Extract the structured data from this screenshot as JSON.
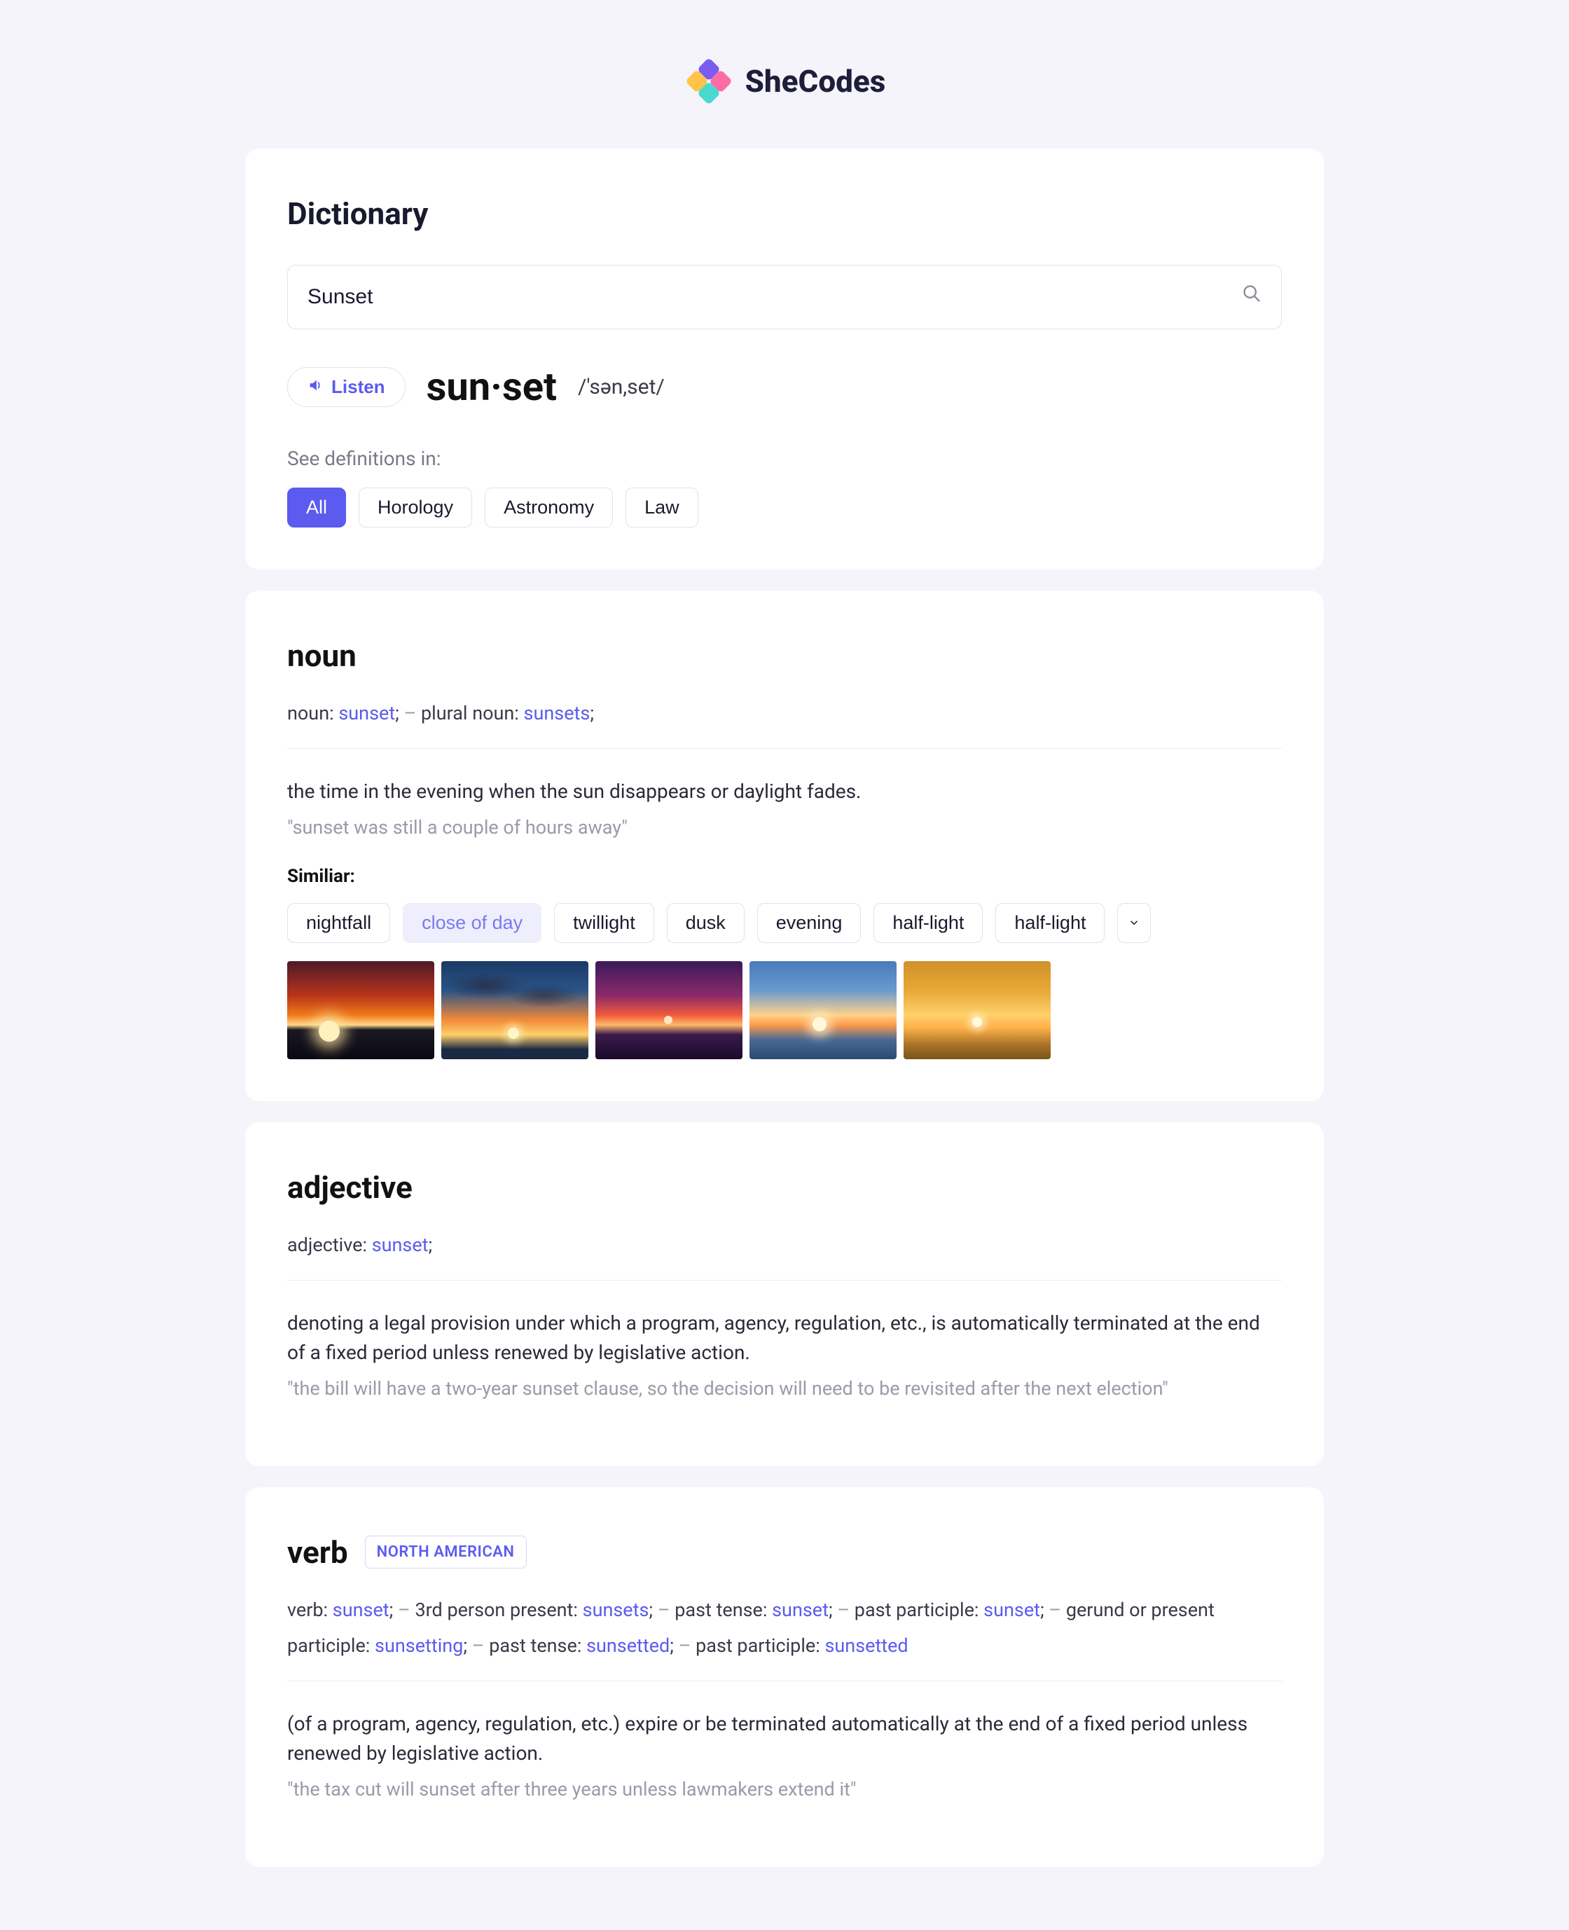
{
  "brand": {
    "name": "SheCodes"
  },
  "header": {
    "title": "Dictionary",
    "search_value": "Sunset",
    "search_placeholder": ""
  },
  "listen_label": "Listen",
  "word_display": "sun·set",
  "phonetic": "/'sən,set/",
  "see_definitions_label": "See definitions in:",
  "category_chips": [
    "All",
    "Horology",
    "Astronomy",
    "Law"
  ],
  "active_category": "All",
  "entries": [
    {
      "pos": "noun",
      "forms_parts": [
        {
          "t": "plain",
          "v": "noun: "
        },
        {
          "t": "hl",
          "v": "sunset"
        },
        {
          "t": "plain",
          "v": ";"
        },
        {
          "t": "sep",
          "v": "   –   "
        },
        {
          "t": "plain",
          "v": "plural noun: "
        },
        {
          "t": "hl",
          "v": "sunsets"
        },
        {
          "t": "plain",
          "v": ";"
        }
      ],
      "definition": "the time in the evening when the sun disappears or daylight fades.",
      "example": "\"sunset was still a couple of hours away\"",
      "similar_label": "Similiar:",
      "similar": [
        "nightfall",
        "close of day",
        "twillight",
        "dusk",
        "evening",
        "half-light",
        "half-light"
      ],
      "soft_similar_index": 1,
      "show_expand": true,
      "thumbs": 5
    },
    {
      "pos": "adjective",
      "forms_parts": [
        {
          "t": "plain",
          "v": "adjective: "
        },
        {
          "t": "hl",
          "v": "sunset"
        },
        {
          "t": "plain",
          "v": ";"
        }
      ],
      "definition": "denoting a legal provision under which a program, agency, regulation, etc., is automatically terminated at the end of a fixed period unless renewed by legislative action.",
      "example": "\"the bill will have a two-year sunset clause, so the decision will need to be revisited after the next election\""
    },
    {
      "pos": "verb",
      "badge": "NORTH AMERICAN",
      "forms_parts": [
        {
          "t": "plain",
          "v": "verb: "
        },
        {
          "t": "hl",
          "v": "sunset"
        },
        {
          "t": "plain",
          "v": ";"
        },
        {
          "t": "sep",
          "v": "   –   "
        },
        {
          "t": "plain",
          "v": "3rd person present: "
        },
        {
          "t": "hl",
          "v": "sunsets"
        },
        {
          "t": "plain",
          "v": ";"
        },
        {
          "t": "sep",
          "v": "   –   "
        },
        {
          "t": "plain",
          "v": "past tense: "
        },
        {
          "t": "hl",
          "v": "sunset"
        },
        {
          "t": "plain",
          "v": ";"
        },
        {
          "t": "sep",
          "v": "   –   "
        },
        {
          "t": "plain",
          "v": "past participle: "
        },
        {
          "t": "hl",
          "v": "sunset"
        },
        {
          "t": "plain",
          "v": ";"
        },
        {
          "t": "sep",
          "v": "   –   "
        },
        {
          "t": "plain",
          "v": "gerund or present participle: "
        },
        {
          "t": "hl",
          "v": "sunsetting"
        },
        {
          "t": "plain",
          "v": ";"
        },
        {
          "t": "sep",
          "v": "   –   "
        },
        {
          "t": "plain",
          "v": "past tense: "
        },
        {
          "t": "hl",
          "v": "sunsetted"
        },
        {
          "t": "plain",
          "v": ";"
        },
        {
          "t": "sep",
          "v": "   –   "
        },
        {
          "t": "plain",
          "v": "past participle: "
        },
        {
          "t": "hl",
          "v": "sunsetted"
        }
      ],
      "definition": "(of a program, agency, regulation, etc.) expire or be terminated automatically at the end of a fixed period unless renewed by legislative action.",
      "example": "\"the tax cut will sunset after three years unless lawmakers extend it\""
    }
  ]
}
